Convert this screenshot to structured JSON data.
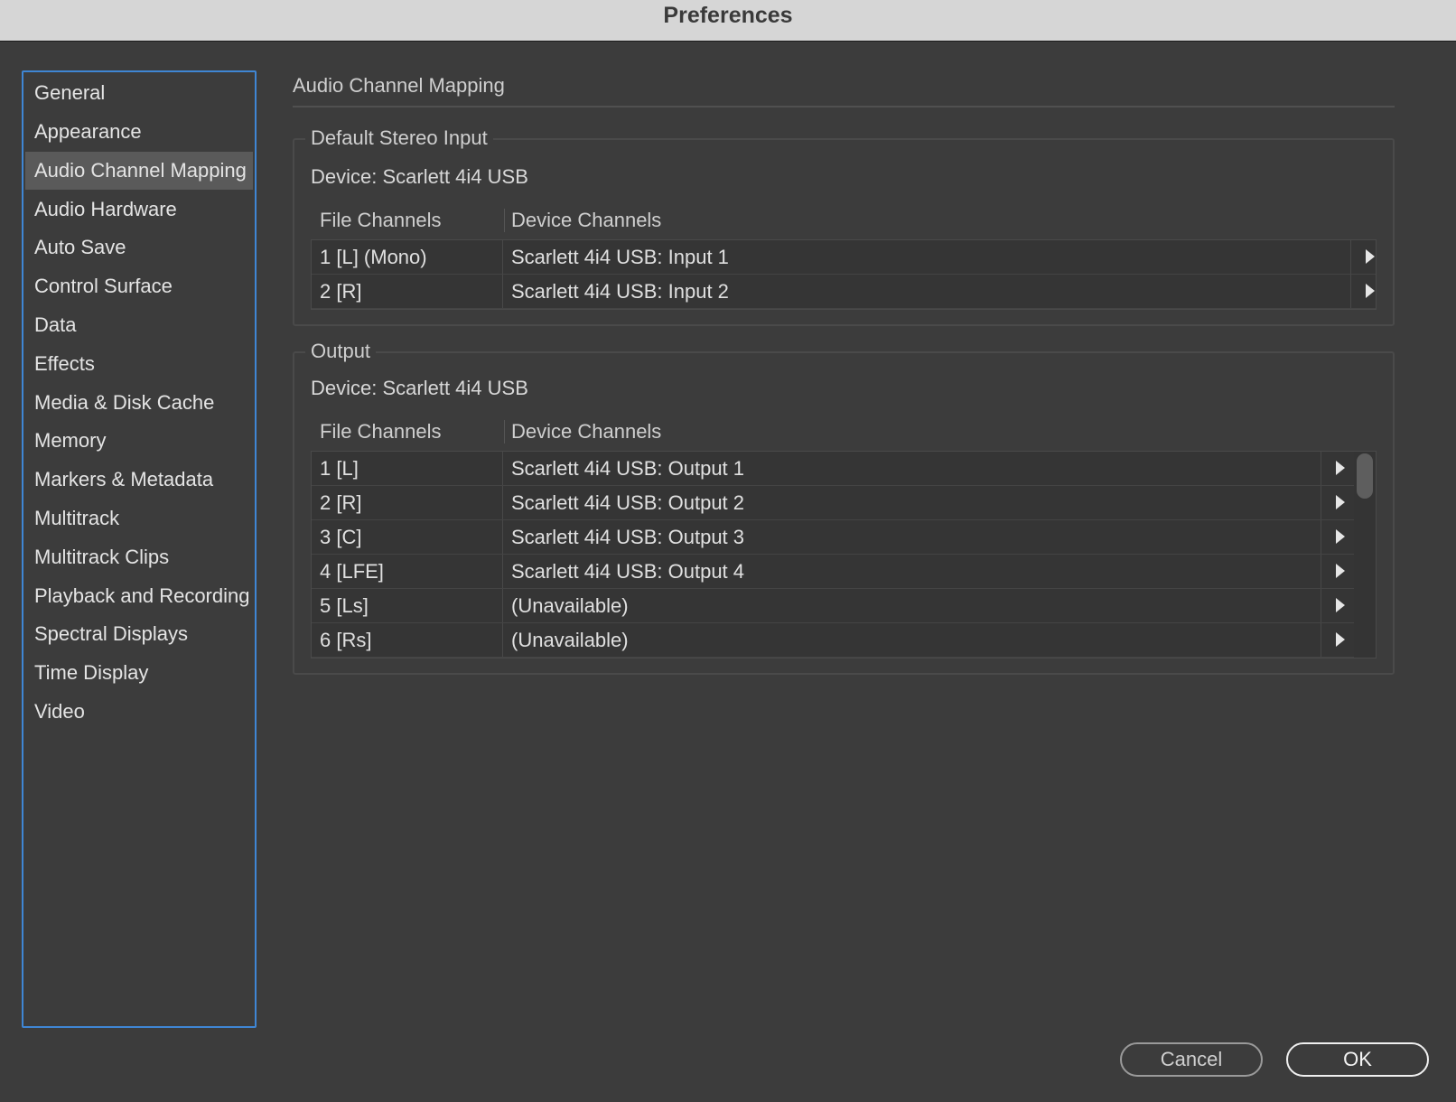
{
  "window": {
    "title": "Preferences"
  },
  "sidebar": {
    "selected": "Audio Channel Mapping",
    "items": [
      {
        "label": "General"
      },
      {
        "label": "Appearance"
      },
      {
        "label": "Audio Channel Mapping"
      },
      {
        "label": "Audio Hardware"
      },
      {
        "label": "Auto Save"
      },
      {
        "label": "Control Surface"
      },
      {
        "label": "Data"
      },
      {
        "label": "Effects"
      },
      {
        "label": "Media & Disk Cache"
      },
      {
        "label": "Memory"
      },
      {
        "label": "Markers & Metadata"
      },
      {
        "label": "Multitrack"
      },
      {
        "label": "Multitrack Clips"
      },
      {
        "label": "Playback and Recording"
      },
      {
        "label": "Spectral Displays"
      },
      {
        "label": "Time Display"
      },
      {
        "label": "Video"
      }
    ]
  },
  "main": {
    "section_title": "Audio Channel Mapping",
    "input": {
      "legend": "Default Stereo Input",
      "device": "Device: Scarlett 4i4 USB",
      "col_file": "File Channels",
      "col_device": "Device Channels",
      "rows": [
        {
          "file": "1 [L] (Mono)",
          "device": "Scarlett 4i4 USB: Input 1"
        },
        {
          "file": "2 [R]",
          "device": "Scarlett 4i4 USB: Input 2"
        }
      ]
    },
    "output": {
      "legend": "Output",
      "device": "Device: Scarlett 4i4 USB",
      "col_file": "File Channels",
      "col_device": "Device Channels",
      "rows": [
        {
          "file": "1 [L]",
          "device": "Scarlett 4i4 USB: Output 1"
        },
        {
          "file": "2 [R]",
          "device": "Scarlett 4i4 USB: Output 2"
        },
        {
          "file": "3 [C]",
          "device": "Scarlett 4i4 USB: Output 3"
        },
        {
          "file": "4 [LFE]",
          "device": "Scarlett 4i4 USB: Output 4"
        },
        {
          "file": "5 [Ls]",
          "device": "(Unavailable)"
        },
        {
          "file": "6 [Rs]",
          "device": "(Unavailable)"
        }
      ]
    }
  },
  "footer": {
    "cancel_label": "Cancel",
    "ok_label": "OK"
  },
  "colors": {
    "background": "#3c3c3c",
    "titlebar": "#d6d6d6",
    "sidebar_border": "#3f86d4",
    "selected_item": "#5a5a5a"
  },
  "icons": {
    "row_menu": "triangle-right-icon"
  }
}
